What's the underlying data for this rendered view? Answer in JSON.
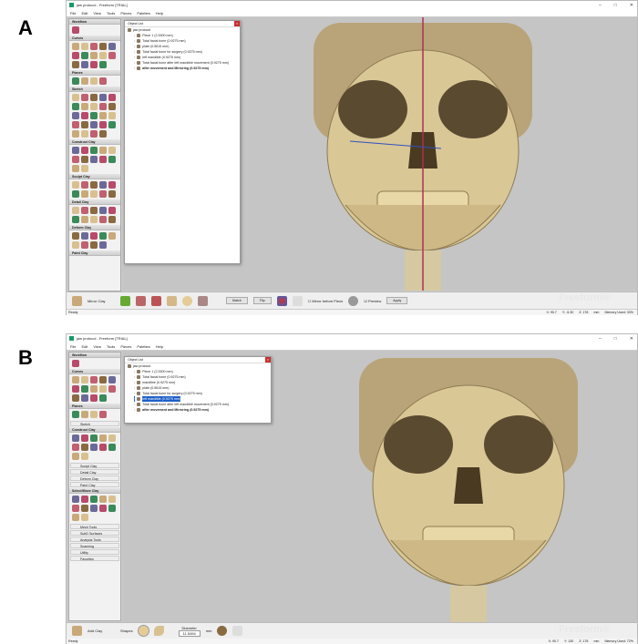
{
  "labels": {
    "a": "A",
    "b": "B"
  },
  "app": {
    "title": "jaw protocol - Freeform [TRIAL]",
    "menu": [
      "File",
      "Edit",
      "View",
      "Tools",
      "Pieces",
      "Palettes",
      "Help"
    ],
    "controls": [
      "–",
      "□",
      "✕"
    ],
    "brand": "Freeform®",
    "brand_sub": "version"
  },
  "panelA": {
    "sidebar": [
      {
        "label": "Workflow",
        "n": 1
      },
      {
        "label": "Curves",
        "n": 14
      },
      {
        "label": "Planes",
        "n": 4
      },
      {
        "label": "Sketch",
        "n": 24
      },
      {
        "label": "Construct Clay",
        "n": 12
      },
      {
        "label": "Sculpt Clay",
        "n": 10
      },
      {
        "label": "Detail Clay",
        "n": 10
      },
      {
        "label": "Deform Clay",
        "n": 9
      },
      {
        "label": "Paint Clay",
        "n": 0
      }
    ],
    "object_list": {
      "title": "Object List",
      "root": "jaw protocol",
      "items": [
        "Piece 1 (2.0000 mm)",
        "Total facial bone (0.9275 mm)",
        "plate (0.5615 mm)",
        "Total facial bone for surgery (0.9275 mm)",
        "left mandible (0.9275 mm)",
        "Total facial bone after left mandible movement (0.9275 mm)",
        "after movement and Mirroring (0.9275 mm)"
      ]
    },
    "toolbar": {
      "mode": "Mirror Clay",
      "match": "Match",
      "flip": "Flip",
      "mirror_before_piece": "Mirror before Piece",
      "preview": "Preview",
      "apply": "Apply"
    },
    "status": {
      "left": "Ready",
      "x": "X: 90.7",
      "y": "Y: -5.30",
      "z": "Z: 178",
      "unit": "mm",
      "memory": "Memory Used: 33%"
    }
  },
  "panelB": {
    "sidebar": [
      {
        "label": "Workflow",
        "n": 1
      },
      {
        "label": "Curves",
        "n": 14
      },
      {
        "label": "Planes",
        "n": 4
      }
    ],
    "collapsed_a": [
      "Sketch"
    ],
    "construct": {
      "label": "Construct Clay",
      "n": 12
    },
    "collapsed_b": [
      "Sculpt Clay",
      "Detail Clay",
      "Deform Clay",
      "Paint Clay"
    ],
    "select": {
      "label": "Select/Move Clay",
      "n": 12
    },
    "collapsed_c": [
      "Mesh Tools",
      "SubD Surfaces",
      "Analysis Tools",
      "Scanning",
      "Utility",
      "Favorites"
    ],
    "object_list": {
      "title": "Object List",
      "root": "jaw protocol",
      "items": [
        "Piece 1 (2.0000 mm)",
        "Total facial bone (0.9275 mm)",
        "mandible (0.9275 mm)",
        "plate (0.5615 mm)",
        "Total facial bone for surgery (0.9275 mm)",
        "left mandible (0.9275 mm)",
        "Total facial bone after left mandible movement (0.9275 mm)",
        "after movement and Mirroring (0.9275 mm)"
      ],
      "selected": 5
    },
    "toolbar": {
      "mode": "Add Clay",
      "shapes": "Shapes",
      "diameter_label": "Diameter",
      "diameter": "11.5494",
      "unit": "mm"
    },
    "status": {
      "left": "Ready",
      "x": "X: 90.7",
      "y": "Y: 130",
      "z": "Z: 178",
      "unit": "mm",
      "memory": "Memory Used: 72%"
    }
  }
}
